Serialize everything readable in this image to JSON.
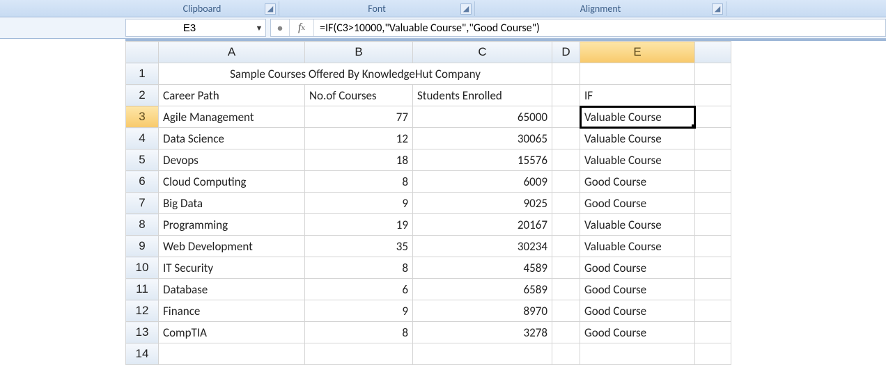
{
  "ribbon": {
    "clipboard": "Clipboard",
    "font": "Font",
    "alignment": "Alignment"
  },
  "nameBox": "E3",
  "formula": "=IF(C3>10000,\"Valuable Course\",\"Good Course\")",
  "columns": [
    "A",
    "B",
    "C",
    "D",
    "E"
  ],
  "selectedCol": "E",
  "selectedRow": 3,
  "title": "Sample Courses Offered By KnowledgeHut Company",
  "headers": {
    "A": "Career Path",
    "B": "No.of Courses",
    "C": "Students Enrolled",
    "E": "IF"
  },
  "chart_data": {
    "type": "table",
    "title": "Sample Courses Offered By KnowledgeHut Company",
    "columns": [
      "Career Path",
      "No.of Courses",
      "Students Enrolled",
      "IF"
    ],
    "rows": [
      {
        "career": "Agile Management",
        "courses": 77,
        "students": 65000,
        "if": "Valuable Course"
      },
      {
        "career": "Data Science",
        "courses": 12,
        "students": 30065,
        "if": "Valuable Course"
      },
      {
        "career": "Devops",
        "courses": 18,
        "students": 15576,
        "if": "Valuable Course"
      },
      {
        "career": "Cloud Computing",
        "courses": 8,
        "students": 6009,
        "if": "Good Course"
      },
      {
        "career": "Big Data",
        "courses": 9,
        "students": 9025,
        "if": "Good Course"
      },
      {
        "career": "Programming",
        "courses": 19,
        "students": 20167,
        "if": "Valuable Course"
      },
      {
        "career": "Web Development",
        "courses": 35,
        "students": 30234,
        "if": "Valuable Course"
      },
      {
        "career": "IT Security",
        "courses": 8,
        "students": 4589,
        "if": "Good Course"
      },
      {
        "career": "Database",
        "courses": 6,
        "students": 6589,
        "if": "Good Course"
      },
      {
        "career": "Finance",
        "courses": 9,
        "students": 8970,
        "if": "Good Course"
      },
      {
        "career": "CompTIA",
        "courses": 8,
        "students": 3278,
        "if": "Good Course"
      }
    ]
  }
}
